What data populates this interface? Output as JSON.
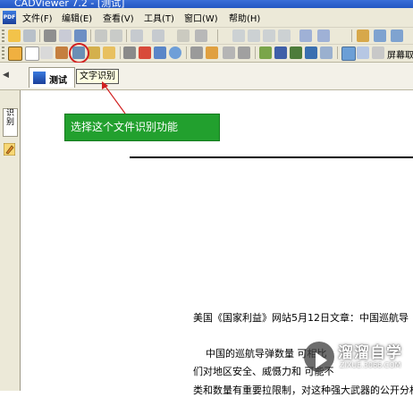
{
  "window": {
    "title": "CADViewer 7.2 - [测试]"
  },
  "menubar": {
    "items": [
      "文件(F)",
      "编辑(E)",
      "查看(V)",
      "工具(T)",
      "窗口(W)",
      "帮助(H)"
    ]
  },
  "toolbar": {
    "screen_capture_label": "屏幕取"
  },
  "tooltip": {
    "text": "文字识别"
  },
  "tabs": [
    {
      "label": "测试"
    }
  ],
  "sidepanel": {
    "tab_label": "识别"
  },
  "annotation": {
    "text": "选择这个文件识别功能"
  },
  "document": {
    "line1": "美国《国家利益》网站5月12日文章：中国巡航导",
    "line2": "中国的巡航导弹数量       可相比",
    "line3": "们对地区安全、威慑力和          可能不",
    "line4": "类和数量有重要拉限制，对这种强大武器的公开分析"
  },
  "watermark": {
    "brand": "溜溜自学",
    "site": "ZIXUE.3066.COM"
  },
  "colors": {
    "toolbar_bg": "#ece9d8",
    "annotation_bg": "#22a02e",
    "highlight_ring": "#d01f1f",
    "tooltip_bg": "#ffffe1"
  }
}
